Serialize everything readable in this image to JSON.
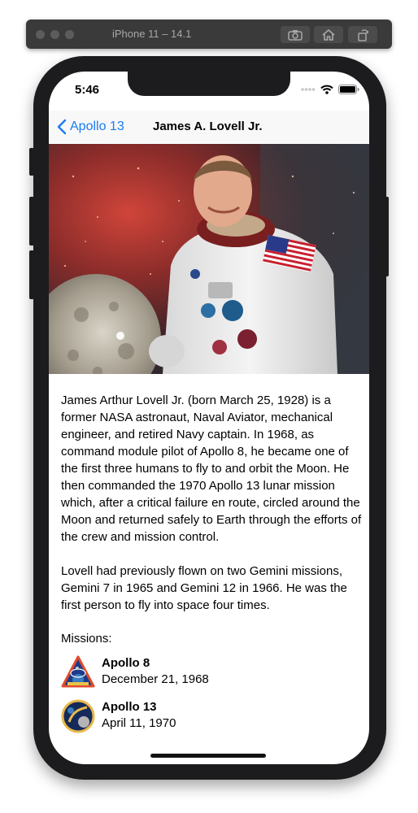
{
  "simulator": {
    "title": "iPhone 11 – 14.1",
    "buttons": [
      "screenshot-icon",
      "home-icon",
      "rotate-icon"
    ]
  },
  "status_bar": {
    "time": "5:46",
    "icons": [
      "signal-dots-icon",
      "wifi-icon",
      "battery-icon"
    ]
  },
  "nav": {
    "back_label": "Apollo 13",
    "title": "James A. Lovell Jr."
  },
  "hero": {
    "icon": "astronaut-portrait-image"
  },
  "bio": {
    "paragraph_1": "James Arthur Lovell Jr. (born March 25, 1928) is a former NASA astronaut, Naval Aviator, mechanical engineer, and retired Navy captain. In 1968, as command module pilot of Apollo 8, he became one of the first three humans to fly to and orbit the Moon. He then commanded the 1970 Apollo 13 lunar mission which, after a critical failure en route, circled around the Moon and returned safely to Earth through the efforts of the crew and mission control.",
    "paragraph_2": "Lovell had previously flown on two Gemini missions, Gemini 7 in 1965 and Gemini 12 in 1966. He was the first person to fly into space four times."
  },
  "missions": {
    "heading": "Missions:",
    "items": [
      {
        "name": "Apollo 8",
        "date": "December 21, 1968",
        "icon": "apollo-8-patch-icon"
      },
      {
        "name": "Apollo 13",
        "date": "April 11, 1970",
        "icon": "apollo-13-patch-icon"
      }
    ]
  },
  "colors": {
    "accent": "#1a7cf4",
    "device": "#1c1c1e"
  }
}
